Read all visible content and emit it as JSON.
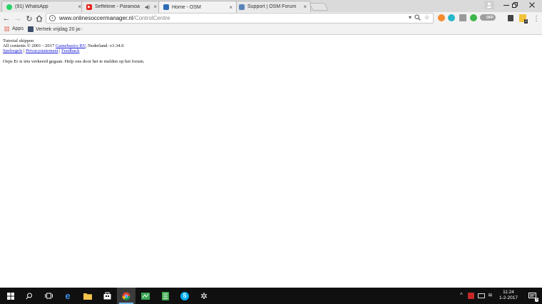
{
  "browser": {
    "tabs": [
      {
        "title": "(91) WhatsApp",
        "icon": "whatsapp-icon",
        "color": "#25d366"
      },
      {
        "title": "Seffelinie - Paranioa",
        "icon": "youtube-icon",
        "color": "#e62117"
      },
      {
        "title": "Home - OSM",
        "icon": "osm-icon",
        "color": "#2d6bb5",
        "active": true
      },
      {
        "title": "Support | OSM Forum",
        "icon": "osm-forum-icon",
        "color": "#5a84b8"
      }
    ],
    "close_glyph": "×",
    "url_host": "www.onlinesoccermanager.nl",
    "url_path": "/ControlCentre",
    "toggle_label": "OFF",
    "extension_badge": "2"
  },
  "bookmarks": {
    "apps_label": "Apps",
    "item_label": "Vertrek vrijdag 20 ja",
    "item_fade": "n"
  },
  "page": {
    "tutorial_skip": "Tutorial skippen",
    "copyright_prefix": "All contents © 2001 - 2017 ",
    "company_link": "Gamebasics BV",
    "copyright_suffix": ", Nederland. v3.34.0",
    "link_rules": "Spelregels",
    "link_privacy": "Privacystatement",
    "link_feedback": "Feedback",
    "separator": " | ",
    "error_message": "Oeps Er is iets verkeerd gegaan. Help ons door het te melden op het forum."
  },
  "taskbar": {
    "time": "11:24",
    "date": "1-2-2017",
    "notification_count": "5",
    "accent": "#76b9ed"
  }
}
